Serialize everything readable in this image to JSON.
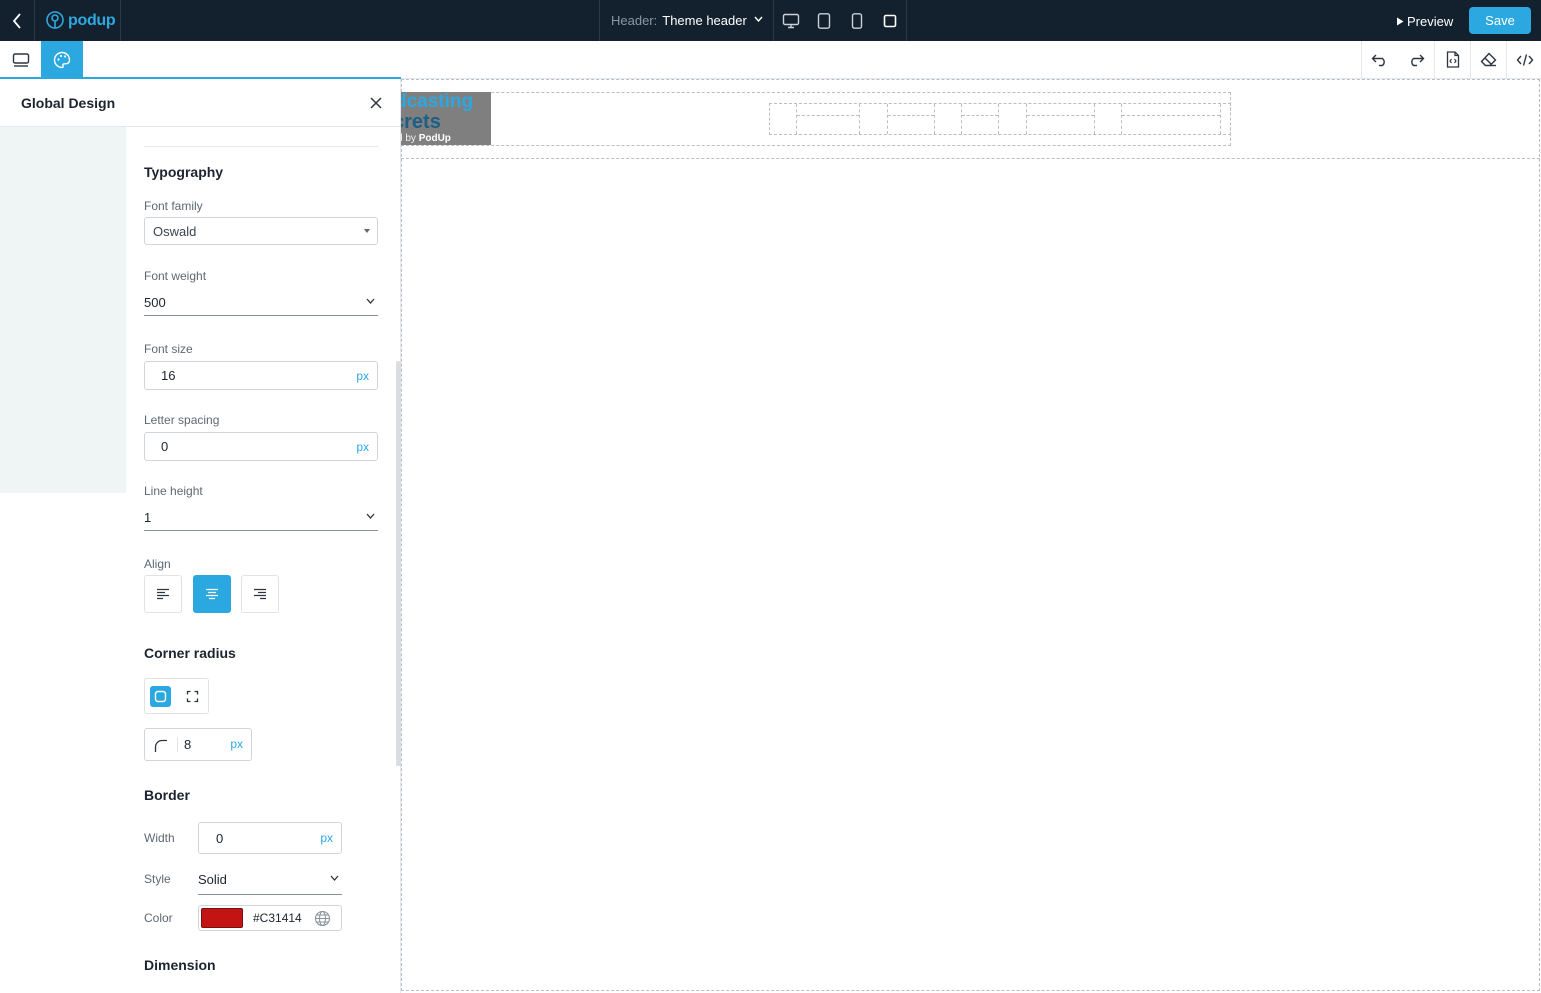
{
  "topbar": {
    "back_icon": "chevron-left-icon",
    "logo": {
      "icon": "podup-mic-icon",
      "text": "podup"
    },
    "header_select": {
      "prefix": "Header:",
      "value": "Theme header"
    },
    "devices": [
      "desktop-icon",
      "tablet-icon",
      "mobile-icon",
      "square-icon"
    ],
    "preview_label": "Preview",
    "save_label": "Save",
    "colors": {
      "bg": "#13212e",
      "accent": "#2ca8e0"
    }
  },
  "toolbar2": {
    "left_tools": [
      "layers-icon",
      "palette-icon"
    ],
    "right_tools": [
      "undo-icon",
      "redo-icon",
      "css-file-icon",
      "eraser-icon",
      "code-icon"
    ]
  },
  "panel": {
    "title": "Global Design",
    "typography": {
      "heading": "Typography",
      "font_family": {
        "label": "Font family",
        "value": "Oswald"
      },
      "font_weight": {
        "label": "Font weight",
        "value": "500"
      },
      "font_size": {
        "label": "Font size",
        "value": "16",
        "unit": "px"
      },
      "letter_spacing": {
        "label": "Letter spacing",
        "value": "0",
        "unit": "px"
      },
      "line_height": {
        "label": "Line height",
        "value": "1"
      },
      "align": {
        "label": "Align",
        "options": [
          "align-left-icon",
          "align-center-icon",
          "align-right-icon"
        ],
        "selected": "align-center-icon"
      }
    },
    "corner_radius": {
      "heading": "Corner radius",
      "modes": [
        "all-corners-icon",
        "individual-corners-icon"
      ],
      "selected_mode": "all-corners-icon",
      "value": "8",
      "unit": "px"
    },
    "border": {
      "heading": "Border",
      "width": {
        "label": "Width",
        "value": "0",
        "unit": "px"
      },
      "style": {
        "label": "Style",
        "value": "Solid"
      },
      "color": {
        "label": "Color",
        "hex": "#C31414",
        "swatch": "#c31414"
      }
    },
    "dimension": {
      "heading": "Dimension"
    }
  },
  "canvas": {
    "logo": {
      "line1": "dcasting",
      "line2": "crets",
      "line3_prefix": "d by",
      "line3_brand": "PodUp"
    }
  }
}
